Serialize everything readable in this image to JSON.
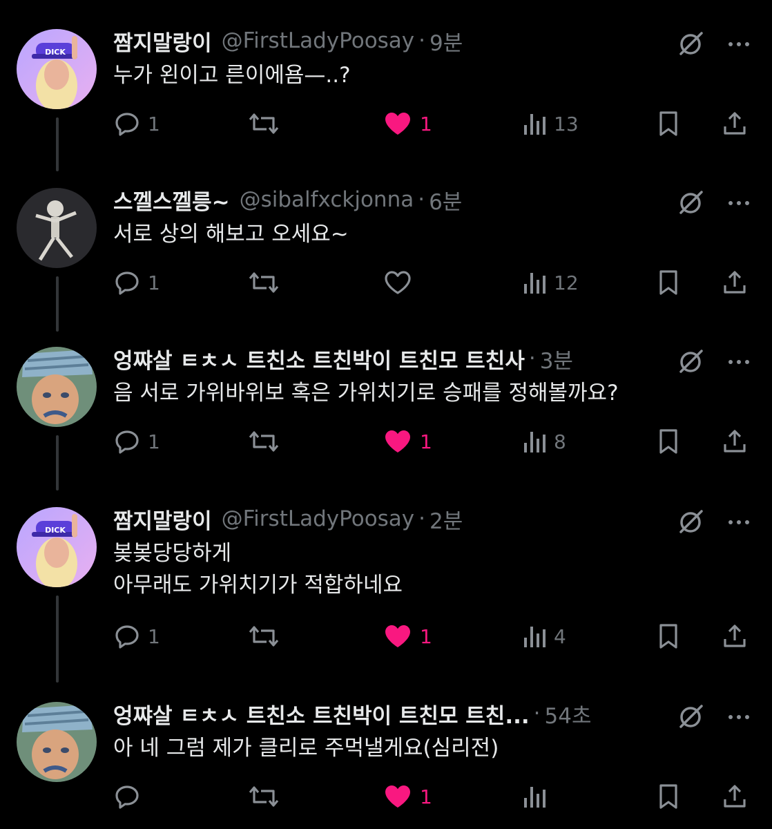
{
  "tweets": [
    {
      "name": "짬지말랑이",
      "handle": "@FirstLadyPoosay",
      "time": "9분",
      "text_lines": [
        "누가 왼이고 른이에욤—..?"
      ],
      "replies": "1",
      "reposts": "",
      "likes": "1",
      "liked": true,
      "views": "13",
      "avatar_text": "DICK"
    },
    {
      "name": "스껠스껠릉~",
      "handle": "@sibalfxckjonna",
      "time": "6분",
      "text_lines": [
        "서로 상의 해보고 오세요~"
      ],
      "replies": "1",
      "reposts": "",
      "likes": "",
      "liked": false,
      "views": "12"
    },
    {
      "name": "엉쨔살 ㅌㅊㅅ 트친소 트친박이 트친모 트친사",
      "handle": "",
      "time": "3분",
      "text_lines": [
        "음 서로 가위바위보 혹은 가위치기로 승패를 정해볼까요?"
      ],
      "replies": "1",
      "reposts": "",
      "likes": "1",
      "liked": true,
      "views": "8"
    },
    {
      "name": "짬지말랑이",
      "handle": "@FirstLadyPoosay",
      "time": "2분",
      "text_lines": [
        "봊봊당당하게",
        "아무래도 가위치기가 적합하네요"
      ],
      "replies": "1",
      "reposts": "",
      "likes": "1",
      "liked": true,
      "views": "4",
      "avatar_text": "DICK"
    },
    {
      "name": "엉쨔살 ㅌㅊㅅ 트친소 트친박이 트친모 트친...",
      "handle": "",
      "time": "54초",
      "text_lines": [
        "아 네 그럼 제가 클리로 주먹낼게요(심리전)"
      ],
      "replies": "",
      "reposts": "",
      "likes": "1",
      "liked": true,
      "views": ""
    }
  ],
  "colors": {
    "like_pink": "#f91880",
    "muted": "#71767b",
    "text": "#e7e9ea",
    "line": "#333639"
  },
  "icons": [
    "reply-icon",
    "repost-icon",
    "like-icon",
    "views-icon",
    "bookmark-icon",
    "share-icon",
    "grok-icon",
    "more-icon"
  ]
}
